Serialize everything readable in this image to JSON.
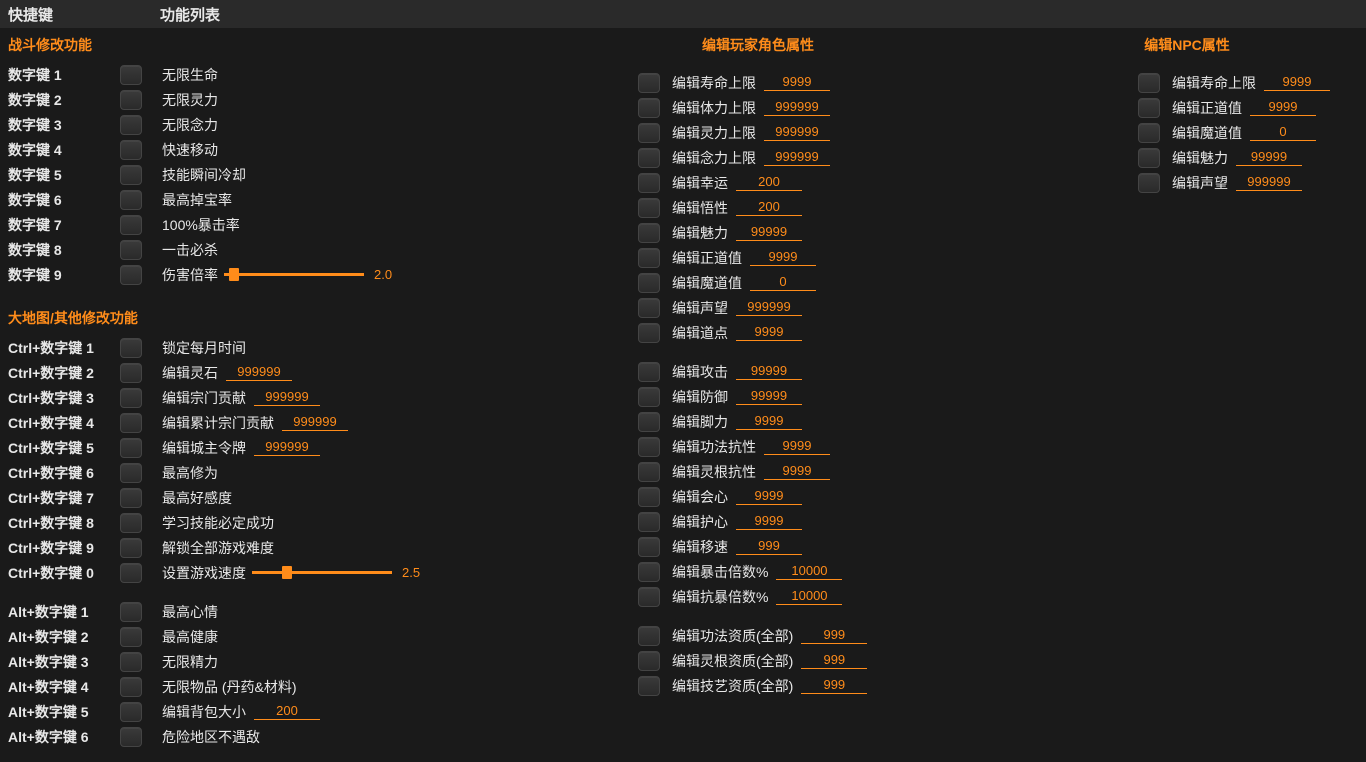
{
  "header": {
    "hotkey": "快捷键",
    "funclist": "功能列表"
  },
  "sections": {
    "combat": "战斗修改功能",
    "map": "大地图/其他修改功能",
    "player": "编辑玩家角色属性",
    "npc": "编辑NPC属性"
  },
  "left": {
    "combat": [
      {
        "hk": "数字键 1",
        "label": "无限生命"
      },
      {
        "hk": "数字键 2",
        "label": "无限灵力"
      },
      {
        "hk": "数字键 3",
        "label": "无限念力"
      },
      {
        "hk": "数字键 4",
        "label": "快速移动"
      },
      {
        "hk": "数字键 5",
        "label": "技能瞬间冷却"
      },
      {
        "hk": "数字键 6",
        "label": "最高掉宝率"
      },
      {
        "hk": "数字键 7",
        "label": "100%暴击率"
      },
      {
        "hk": "数字键 8",
        "label": "一击必杀"
      },
      {
        "hk": "数字键 9",
        "label": "伤害倍率",
        "slider": "2.0",
        "pos": 5
      }
    ],
    "map": [
      {
        "hk": "Ctrl+数字键 1",
        "label": "锁定每月时间"
      },
      {
        "hk": "Ctrl+数字键 2",
        "label": "编辑灵石",
        "val": "999999"
      },
      {
        "hk": "Ctrl+数字键 3",
        "label": "编辑宗门贡献",
        "val": "999999"
      },
      {
        "hk": "Ctrl+数字键 4",
        "label": "编辑累计宗门贡献",
        "val": "999999"
      },
      {
        "hk": "Ctrl+数字键 5",
        "label": "编辑城主令牌",
        "val": "999999"
      },
      {
        "hk": "Ctrl+数字键 6",
        "label": "最高修为"
      },
      {
        "hk": "Ctrl+数字键 7",
        "label": "最高好感度"
      },
      {
        "hk": "Ctrl+数字键 8",
        "label": "学习技能必定成功"
      },
      {
        "hk": "Ctrl+数字键 9",
        "label": "解锁全部游戏难度"
      },
      {
        "hk": "Ctrl+数字键 0",
        "label": "设置游戏速度",
        "slider": "2.5",
        "pos": 30
      }
    ],
    "alt": [
      {
        "hk": "Alt+数字键 1",
        "label": "最高心情"
      },
      {
        "hk": "Alt+数字键 2",
        "label": "最高健康"
      },
      {
        "hk": "Alt+数字键 3",
        "label": "无限精力"
      },
      {
        "hk": "Alt+数字键 4",
        "label": "无限物品 (丹药&材料)"
      },
      {
        "hk": "Alt+数字键 5",
        "label": "编辑背包大小",
        "val": "200"
      },
      {
        "hk": "Alt+数字键 6",
        "label": "危险地区不遇敌"
      }
    ]
  },
  "player": {
    "g1": [
      {
        "label": "编辑寿命上限",
        "val": "9999"
      },
      {
        "label": "编辑体力上限",
        "val": "999999"
      },
      {
        "label": "编辑灵力上限",
        "val": "999999"
      },
      {
        "label": "编辑念力上限",
        "val": "999999"
      },
      {
        "label": "编辑幸运",
        "val": "200"
      },
      {
        "label": "编辑悟性",
        "val": "200"
      },
      {
        "label": "编辑魅力",
        "val": "99999"
      },
      {
        "label": "编辑正道值",
        "val": "9999"
      },
      {
        "label": "编辑魔道值",
        "val": "0"
      },
      {
        "label": "编辑声望",
        "val": "999999"
      },
      {
        "label": "编辑道点",
        "val": "9999"
      }
    ],
    "g2": [
      {
        "label": "编辑攻击",
        "val": "99999"
      },
      {
        "label": "编辑防御",
        "val": "99999"
      },
      {
        "label": "编辑脚力",
        "val": "9999"
      },
      {
        "label": "编辑功法抗性",
        "val": "9999"
      },
      {
        "label": "编辑灵根抗性",
        "val": "9999"
      },
      {
        "label": "编辑会心",
        "val": "9999"
      },
      {
        "label": "编辑护心",
        "val": "9999"
      },
      {
        "label": "编辑移速",
        "val": "999"
      },
      {
        "label": "编辑暴击倍数%",
        "val": "10000"
      },
      {
        "label": "编辑抗暴倍数%",
        "val": "10000"
      }
    ],
    "g3": [
      {
        "label": "编辑功法资质(全部)",
        "val": "999"
      },
      {
        "label": "编辑灵根资质(全部)",
        "val": "999"
      },
      {
        "label": "编辑技艺资质(全部)",
        "val": "999"
      }
    ]
  },
  "npc": [
    {
      "label": "编辑寿命上限",
      "val": "9999"
    },
    {
      "label": "编辑正道值",
      "val": "9999"
    },
    {
      "label": "编辑魔道值",
      "val": "0"
    },
    {
      "label": "编辑魅力",
      "val": "99999"
    },
    {
      "label": "编辑声望",
      "val": "999999"
    }
  ]
}
